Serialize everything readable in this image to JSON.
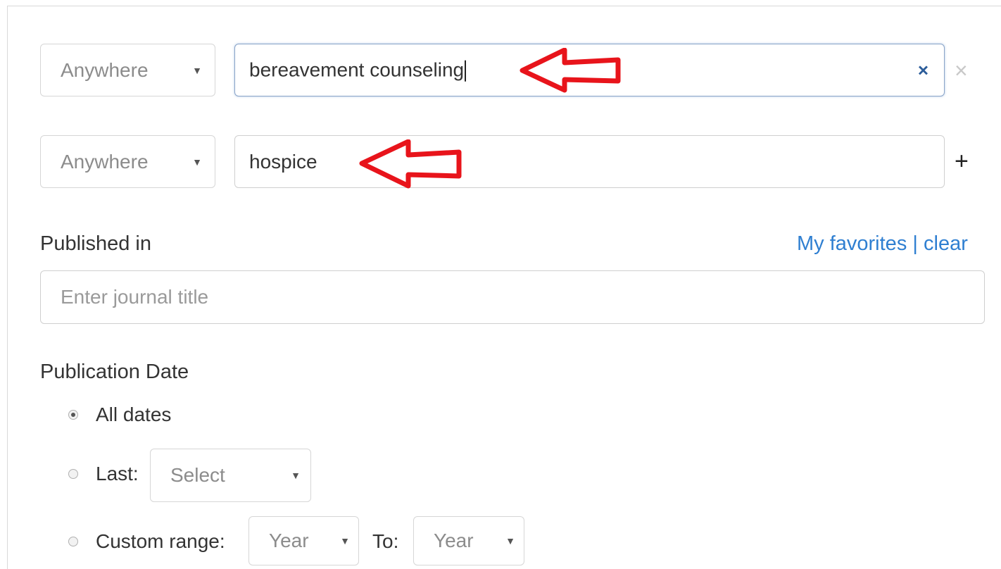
{
  "search_rows": [
    {
      "field_select": "Anywhere",
      "query": "bereavement counseling",
      "clear_icon": "×",
      "row_action_icon": "×"
    },
    {
      "field_select": "Anywhere",
      "query": "hospice",
      "row_action_icon": "+"
    }
  ],
  "published_in": {
    "label": "Published in",
    "favorites_link": "My favorites",
    "separator": "|",
    "clear_link": "clear",
    "placeholder": "Enter journal title"
  },
  "publication_date": {
    "label": "Publication Date",
    "options": {
      "all_dates": "All dates",
      "last": "Last:",
      "last_select": "Select",
      "custom_range": "Custom range:",
      "from_select": "Year",
      "to_label": "To:",
      "to_select": "Year"
    },
    "selected": "all_dates"
  },
  "colors": {
    "link": "#2f7fd1",
    "arrow_annotation": "#e8141b",
    "clear_icon": "#2c5d9a"
  },
  "icons": {
    "caret": "▼",
    "annotation": "red-arrow-icon"
  }
}
